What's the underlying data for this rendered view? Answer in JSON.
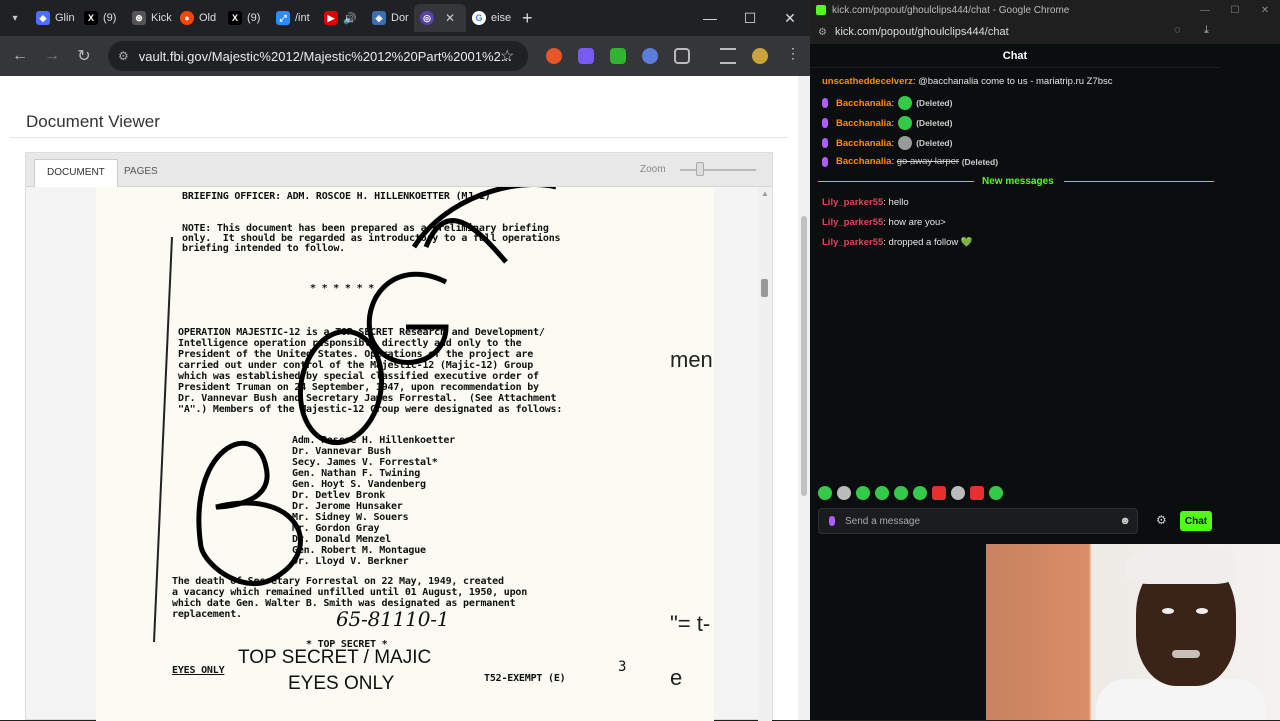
{
  "left_browser": {
    "tabs": [
      {
        "label": "Glin",
        "color": "#4c6fff",
        "icon": "diamond-icon"
      },
      {
        "label": "(9)",
        "color": "#000000",
        "icon": "x-icon"
      },
      {
        "label": "Kick",
        "color": "#555555",
        "icon": "openai-icon"
      },
      {
        "label": "Old",
        "color": "#ff4500",
        "icon": "reddit-icon"
      },
      {
        "label": "(9)",
        "color": "#000000",
        "icon": "x-icon"
      },
      {
        "label": "/int",
        "color": "#2a8cff",
        "icon": "expand-icon"
      },
      {
        "label": "",
        "color": "#e00000",
        "icon": "youtube-icon"
      },
      {
        "label": "Dor",
        "color": "#3a6fb0",
        "icon": "shield-icon"
      },
      {
        "label": "",
        "color": "#5a3fb0",
        "icon": "globe-icon"
      },
      {
        "label": "eise",
        "color": "#4285f4",
        "icon": "google-icon"
      }
    ],
    "url": "vault.fbi.gov/Majestic%2012/Majestic%2012%20Part%2001%2...",
    "page": {
      "title": "Document Viewer",
      "tabs": [
        "DOCUMENT",
        "PAGES"
      ],
      "zoom_label": "Zoom"
    },
    "document": {
      "lines": [
        "BRIEFING OFFICER: ADM. ROSCOE H. HILLENKOETTER (MJ-1)",
        "NOTE: This document has been prepared as a preliminary briefing",
        "only.  It should be regarded as introductory to a full operations",
        "briefing intended to follow.",
        "* * * * * *",
        "OPERATION MAJESTIC-12 is a TOP SECRET Research and Development/",
        "Intelligence operation responsible directly and only to the",
        "President of the United States. Operations of the project are",
        "carried out under control of the Majestic-12 (Majic-12) Group",
        "which was established by special classified executive order of",
        "President Truman on 24 September, 1947, upon recommendation by",
        "Dr. Vannevar Bush and Secretary James Forrestal.  (See Attachment",
        "\"A\".) Members of the Majestic-12 Group were designated as follows:",
        "Adm. Roscoe H. Hillenkoetter",
        "Dr. Vannevar Bush",
        "Secy. James V. Forrestal*",
        "Gen. Nathan F. Twining",
        "Gen. Hoyt S. Vandenberg",
        "Dr. Detlev Bronk",
        "Dr. Jerome Hunsaker",
        "Mr. Sidney W. Souers",
        "Mr. Gordon Gray",
        "Dr. Donald Menzel",
        "Gen. Robert M. Montague",
        "Dr. Lloyd V. Berkner",
        "The death of Secretary Forrestal on 22 May, 1949, created",
        "a vacancy which remained unfilled until 01 August, 1950, upon",
        "which date Gen. Walter B. Smith was designated as permanent",
        "replacement.",
        "65-81110-1",
        "* TOP SECRET *",
        "EYES ONLY",
        "T52-EXEMPT (E)",
        "3"
      ],
      "stamp_line1": "TOP SECRET / MAJIC",
      "stamp_line2": "EYES ONLY",
      "side_fragment_1": "men",
      "side_fragment_2": "\"= t-",
      "side_fragment_3": "e"
    }
  },
  "chat_window": {
    "window_title": "kick.com/popout/ghoulclips444/chat - Google Chrome",
    "url": "kick.com/popout/ghoulclips444/chat",
    "header": "Chat",
    "messages": [
      {
        "user": "unscatheddecelverz",
        "color": "#ff8c00",
        "text": "@bacchanalia come to us - mariatrip.ru Z7bsc",
        "has_mic": false,
        "emote": false,
        "deleted": ""
      },
      {
        "user": "Bacchanalia",
        "color": "#ff8c00",
        "text": "",
        "has_mic": true,
        "emote": true,
        "deleted": "(Deleted)"
      },
      {
        "user": "Bacchanalia",
        "color": "#ff8c00",
        "text": "",
        "has_mic": true,
        "emote": true,
        "deleted": "(Deleted)"
      },
      {
        "user": "Bacchanalia",
        "color": "#ff8c00",
        "text": "",
        "has_mic": true,
        "emote": true,
        "deleted": "(Deleted)"
      },
      {
        "user": "Bacchanalia",
        "color": "#ff8c00",
        "text": "go away larper",
        "has_mic": true,
        "emote": false,
        "deleted": "(Deleted)",
        "strike": true
      }
    ],
    "new_messages_label": "New messages",
    "new_messages": [
      {
        "user": "Lily_parker55",
        "color": "#e8405a",
        "text": "hello"
      },
      {
        "user": "Lily_parker55",
        "color": "#e8405a",
        "text": "how are you>"
      },
      {
        "user": "Lily_parker55",
        "color": "#e8405a",
        "text": "dropped a follow 💚"
      }
    ],
    "input_placeholder": "Send a message",
    "send_label": "Chat",
    "accent": "#53fc18"
  }
}
